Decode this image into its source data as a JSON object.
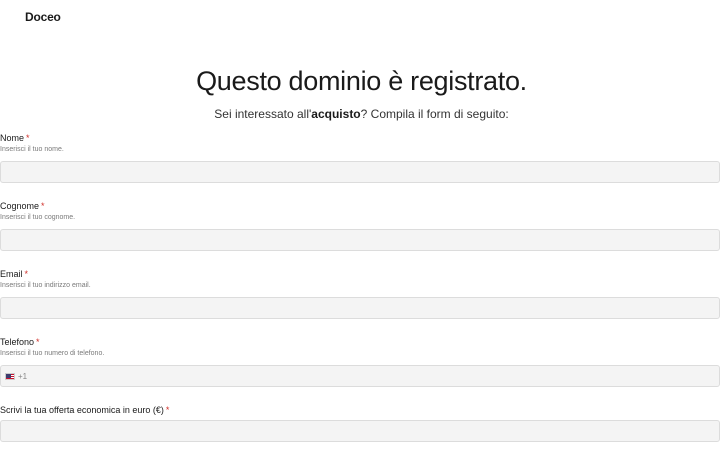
{
  "brand": {
    "name": "Doceo"
  },
  "hero": {
    "title": "Questo dominio è registrato.",
    "subtitle_before": "Sei interessato all'",
    "subtitle_bold": "acquisto",
    "subtitle_after": "? Compila il form di seguito:"
  },
  "form": {
    "required_marker": "*",
    "fields": [
      {
        "label": "Nome",
        "help": "Inserisci il tuo nome.",
        "value": ""
      },
      {
        "label": "Cognome",
        "help": "Inserisci il tuo cognome.",
        "value": ""
      },
      {
        "label": "Email",
        "help": "Inserisci il tuo indirizzo email.",
        "value": ""
      },
      {
        "label": "Telefono",
        "help": "Inserisci il tuo numero di telefono.",
        "value": "",
        "country_icon": "us-flag-icon",
        "dial_code": "+1"
      },
      {
        "label": "Scrivi la tua offerta economica in euro (€)",
        "help": "",
        "value": ""
      }
    ]
  }
}
